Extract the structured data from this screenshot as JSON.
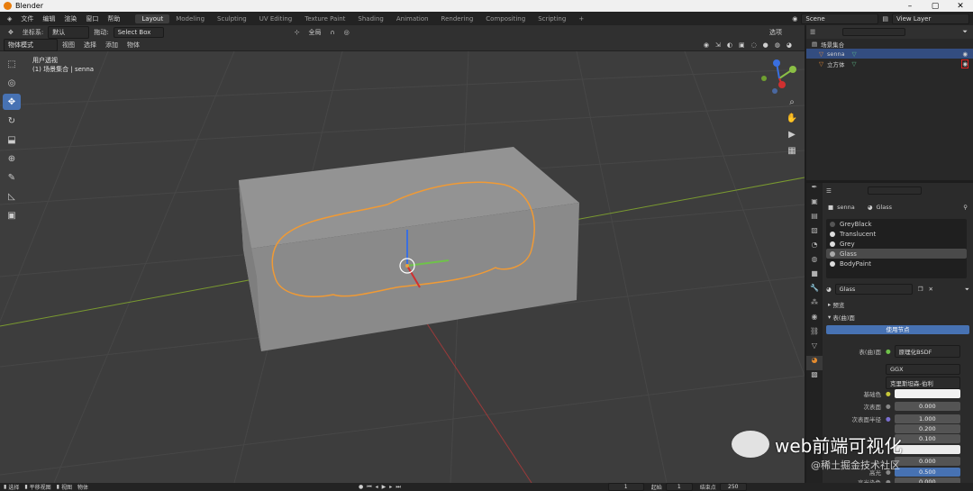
{
  "window": {
    "title": "Blender"
  },
  "window_controls": {
    "minimize": "–",
    "maximize": "▢",
    "close": "✕"
  },
  "menu": [
    "文件",
    "编辑",
    "渲染",
    "窗口",
    "帮助"
  ],
  "workspaces": [
    {
      "label": "Layout",
      "active": true
    },
    {
      "label": "Modeling"
    },
    {
      "label": "Sculpting"
    },
    {
      "label": "UV Editing"
    },
    {
      "label": "Texture Paint"
    },
    {
      "label": "Shading"
    },
    {
      "label": "Animation"
    },
    {
      "label": "Rendering"
    },
    {
      "label": "Compositing"
    },
    {
      "label": "Scripting"
    },
    {
      "label": "+"
    }
  ],
  "scene": {
    "label": "Scene",
    "view_layer": "View Layer"
  },
  "header": {
    "orientation_label": "坐标系:",
    "orientation_value": "默认",
    "drag_label": "拖动:",
    "drag_value": "Select Box",
    "pivot": "全局",
    "options": "选项"
  },
  "header2": {
    "mode": "物体模式",
    "items": [
      "视图",
      "选择",
      "添加",
      "物体"
    ]
  },
  "viewport": {
    "line1": "用户透视",
    "line2": "(1) 场景集合 | senna"
  },
  "outliner": {
    "collection": "场景集合",
    "objects": [
      {
        "name": "senna",
        "selected": true
      },
      {
        "name": "立方体",
        "selected": false
      }
    ]
  },
  "props": {
    "object": "senna",
    "material_tab": "Glass",
    "materials": [
      {
        "name": "GreyBlack",
        "color": "#555555"
      },
      {
        "name": "Translucent",
        "color": "#dddddd"
      },
      {
        "name": "Grey",
        "color": "#cccccc"
      },
      {
        "name": "Glass",
        "color": "#bbbbbb",
        "selected": true
      },
      {
        "name": "BodyPaint",
        "color": "#eeeeee"
      }
    ],
    "material_name": "Glass",
    "section_preview": "预览",
    "section_surface": "表(曲)面",
    "use_nodes": "使用节点",
    "surface_label": "表(曲)面",
    "surface_value": "原理化BSDF",
    "distribution": "GGX",
    "subsurface_method": "克里斯坦森-伯利",
    "rows": [
      {
        "label": "基础色",
        "value": "",
        "type": "color"
      },
      {
        "label": "次表面",
        "value": "0.000"
      },
      {
        "label": "次表面半径",
        "value": "1.000"
      },
      {
        "label": "",
        "value": "0.200"
      },
      {
        "label": "",
        "value": "0.100"
      },
      {
        "label": "",
        "value": ""
      },
      {
        "label": "",
        "value": "0.000"
      },
      {
        "label": "高光",
        "value": "0.500"
      },
      {
        "label": "高光染色",
        "value": "0.000"
      }
    ]
  },
  "status": {
    "select": "选择",
    "box": "平移视图",
    "view": "视图",
    "context": "物体",
    "frame": "1",
    "start_label": "起始",
    "start": "1",
    "end_label": "结束点",
    "end": "250"
  },
  "watermark": {
    "main": "web前端可视化",
    "sub": "@稀土掘金技术社区"
  }
}
